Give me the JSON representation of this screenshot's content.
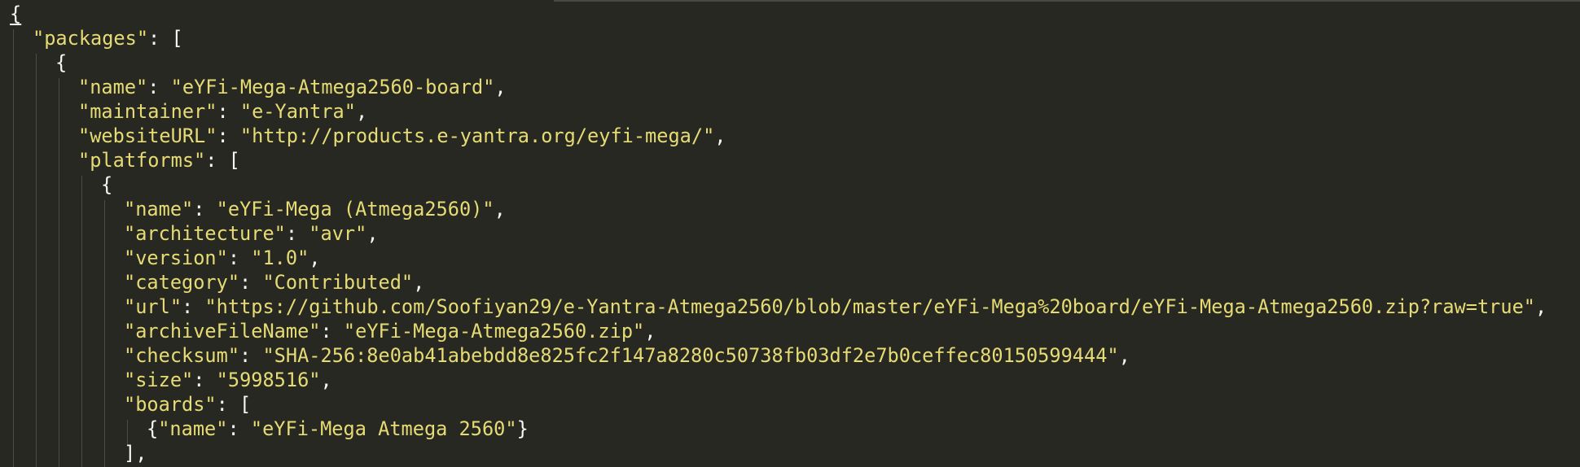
{
  "editor": {
    "language": "JSON",
    "theme_colors": {
      "background": "#272822",
      "string": "#e6db74",
      "punctuation": "#f8f8f2",
      "indent_guide": "#4b4c44"
    },
    "lines": [
      {
        "indent": 0,
        "tokens": [
          {
            "t": "punc",
            "v": "{"
          }
        ]
      },
      {
        "indent": 1,
        "tokens": [
          {
            "t": "key",
            "v": "\"packages\""
          },
          {
            "t": "punc",
            "v": ": ["
          }
        ]
      },
      {
        "indent": 2,
        "tokens": [
          {
            "t": "punc",
            "v": "{"
          }
        ]
      },
      {
        "indent": 3,
        "tokens": [
          {
            "t": "key",
            "v": "\"name\""
          },
          {
            "t": "punc",
            "v": ": "
          },
          {
            "t": "str",
            "v": "\"eYFi-Mega-Atmega2560-board\""
          },
          {
            "t": "punc",
            "v": ","
          }
        ]
      },
      {
        "indent": 3,
        "tokens": [
          {
            "t": "key",
            "v": "\"maintainer\""
          },
          {
            "t": "punc",
            "v": ": "
          },
          {
            "t": "str",
            "v": "\"e-Yantra\""
          },
          {
            "t": "punc",
            "v": ","
          }
        ]
      },
      {
        "indent": 3,
        "tokens": [
          {
            "t": "key",
            "v": "\"websiteURL\""
          },
          {
            "t": "punc",
            "v": ": "
          },
          {
            "t": "str",
            "v": "\"http://products.e-yantra.org/eyfi-mega/\""
          },
          {
            "t": "punc",
            "v": ","
          }
        ]
      },
      {
        "indent": 3,
        "tokens": [
          {
            "t": "key",
            "v": "\"platforms\""
          },
          {
            "t": "punc",
            "v": ": ["
          }
        ]
      },
      {
        "indent": 4,
        "tokens": [
          {
            "t": "punc",
            "v": "{"
          }
        ]
      },
      {
        "indent": 5,
        "tokens": [
          {
            "t": "key",
            "v": "\"name\""
          },
          {
            "t": "punc",
            "v": ": "
          },
          {
            "t": "str",
            "v": "\"eYFi-Mega (Atmega2560)\""
          },
          {
            "t": "punc",
            "v": ","
          }
        ]
      },
      {
        "indent": 5,
        "tokens": [
          {
            "t": "key",
            "v": "\"architecture\""
          },
          {
            "t": "punc",
            "v": ": "
          },
          {
            "t": "str",
            "v": "\"avr\""
          },
          {
            "t": "punc",
            "v": ","
          }
        ]
      },
      {
        "indent": 5,
        "tokens": [
          {
            "t": "key",
            "v": "\"version\""
          },
          {
            "t": "punc",
            "v": ": "
          },
          {
            "t": "str",
            "v": "\"1.0\""
          },
          {
            "t": "punc",
            "v": ","
          }
        ]
      },
      {
        "indent": 5,
        "tokens": [
          {
            "t": "key",
            "v": "\"category\""
          },
          {
            "t": "punc",
            "v": ": "
          },
          {
            "t": "str",
            "v": "\"Contributed\""
          },
          {
            "t": "punc",
            "v": ","
          }
        ]
      },
      {
        "indent": 5,
        "tokens": [
          {
            "t": "key",
            "v": "\"url\""
          },
          {
            "t": "punc",
            "v": ": "
          },
          {
            "t": "str",
            "v": "\"https://github.com/Soofiyan29/e-Yantra-Atmega2560/blob/master/eYFi-Mega%20board/eYFi-Mega-Atmega2560.zip?raw=true\""
          },
          {
            "t": "punc",
            "v": ","
          }
        ]
      },
      {
        "indent": 5,
        "tokens": [
          {
            "t": "key",
            "v": "\"archiveFileName\""
          },
          {
            "t": "punc",
            "v": ": "
          },
          {
            "t": "str",
            "v": "\"eYFi-Mega-Atmega2560.zip\""
          },
          {
            "t": "punc",
            "v": ","
          }
        ]
      },
      {
        "indent": 5,
        "tokens": [
          {
            "t": "key",
            "v": "\"checksum\""
          },
          {
            "t": "punc",
            "v": ": "
          },
          {
            "t": "str",
            "v": "\"SHA-256:8e0ab41abebdd8e825fc2f147a8280c50738fb03df2e7b0ceffec80150599444\""
          },
          {
            "t": "punc",
            "v": ","
          }
        ]
      },
      {
        "indent": 5,
        "tokens": [
          {
            "t": "key",
            "v": "\"size\""
          },
          {
            "t": "punc",
            "v": ": "
          },
          {
            "t": "str",
            "v": "\"5998516\""
          },
          {
            "t": "punc",
            "v": ","
          }
        ]
      },
      {
        "indent": 5,
        "tokens": [
          {
            "t": "key",
            "v": "\"boards\""
          },
          {
            "t": "punc",
            "v": ": ["
          }
        ]
      },
      {
        "indent": 6,
        "tokens": [
          {
            "t": "punc",
            "v": "{"
          },
          {
            "t": "key",
            "v": "\"name\""
          },
          {
            "t": "punc",
            "v": ": "
          },
          {
            "t": "str",
            "v": "\"eYFi-Mega Atmega 2560\""
          },
          {
            "t": "punc",
            "v": "}"
          }
        ]
      },
      {
        "indent": 5,
        "tokens": [
          {
            "t": "punc",
            "v": "],"
          }
        ]
      }
    ]
  }
}
